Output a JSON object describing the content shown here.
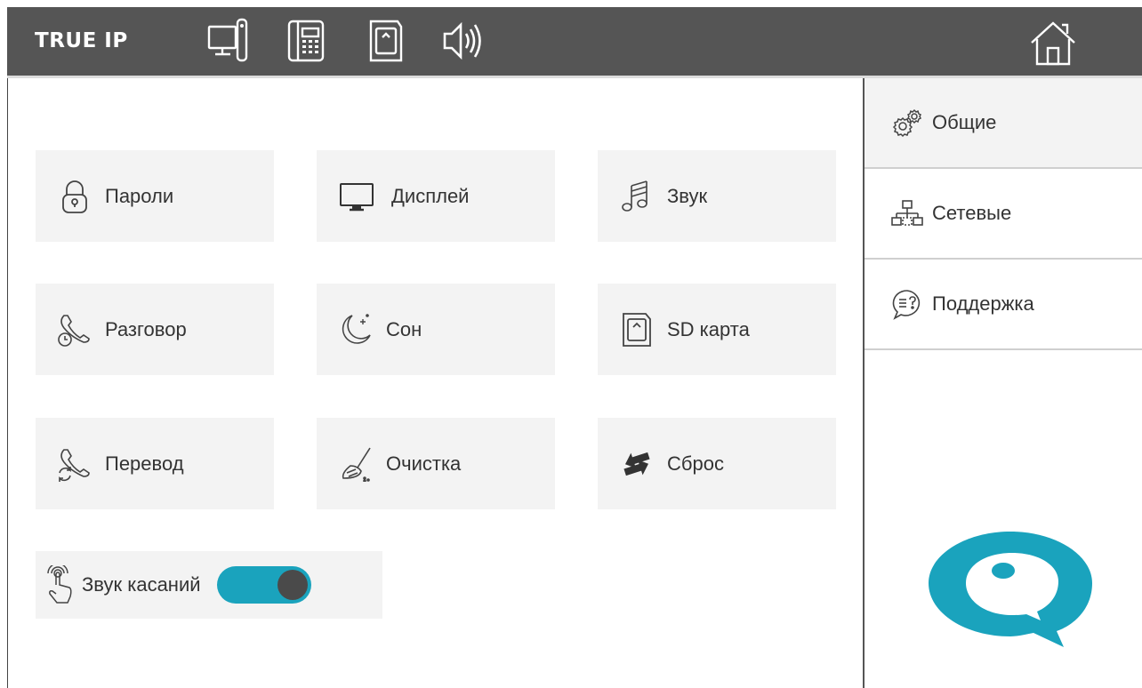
{
  "header": {
    "brand": "TRUE IP",
    "icons": [
      "monitor-handset-icon",
      "intercom-phone-icon",
      "sd-card-icon",
      "speaker-icon"
    ],
    "home_icon": "home-icon"
  },
  "tiles": [
    {
      "label": "Пароли",
      "icon": "padlock-icon"
    },
    {
      "label": "Дисплей",
      "icon": "monitor-icon"
    },
    {
      "label": "Звук",
      "icon": "music-note-icon"
    },
    {
      "label": "Разговор",
      "icon": "handset-clock-icon"
    },
    {
      "label": "Сон",
      "icon": "moon-icon"
    },
    {
      "label": "SD карта",
      "icon": "sd-card-icon"
    },
    {
      "label": "Перевод",
      "icon": "handset-transfer-icon"
    },
    {
      "label": "Очистка",
      "icon": "broom-icon"
    },
    {
      "label": "Сброс",
      "icon": "reset-arrows-icon"
    }
  ],
  "touch_sound": {
    "label": "Звук касаний",
    "enabled": true,
    "icon": "touch-finger-icon"
  },
  "sidebar": {
    "items": [
      {
        "label": "Общие",
        "icon": "gears-icon",
        "active": true
      },
      {
        "label": "Сетевые",
        "icon": "network-icon",
        "active": false
      },
      {
        "label": "Поддержка",
        "icon": "support-bubble-icon",
        "active": false
      }
    ]
  },
  "colors": {
    "accent": "#1aa3bd",
    "header": "#555555",
    "tile": "#f3f3f3"
  }
}
